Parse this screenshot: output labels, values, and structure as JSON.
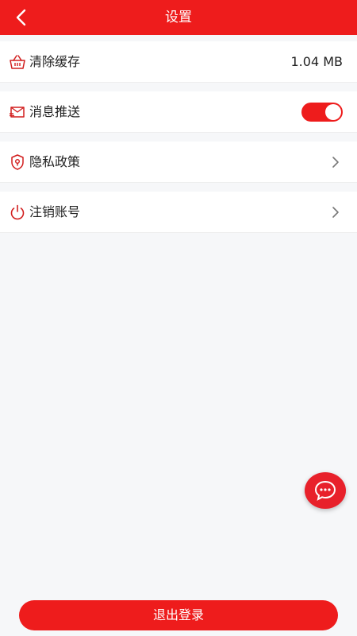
{
  "header": {
    "title": "设置",
    "back_icon": "chevron-left-icon"
  },
  "settings": [
    {
      "label": "清除缓存",
      "icon": "basket-icon",
      "value": "1.04 MB"
    },
    {
      "label": "消息推送",
      "icon": "message-icon",
      "toggle_on": true
    },
    {
      "label": "隐私政策",
      "icon": "shield-location-icon"
    },
    {
      "label": "注销账号",
      "icon": "power-icon"
    }
  ],
  "fab": {
    "icon": "chat-bubble-icon"
  },
  "logout": {
    "label": "退出登录"
  },
  "colors": {
    "primary": "#ee1c1c",
    "background": "#f6f7f9",
    "text": "#222222"
  }
}
